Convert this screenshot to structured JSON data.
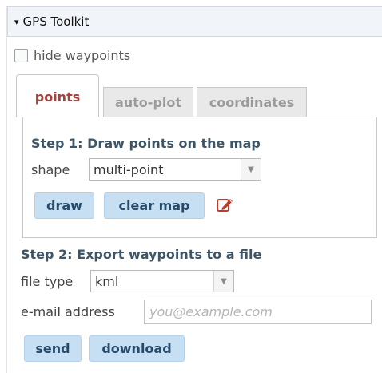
{
  "panel": {
    "title": "GPS Toolkit",
    "caret": "▾"
  },
  "hide_waypoints": {
    "label": "hide waypoints",
    "checked": false
  },
  "tabs": [
    {
      "label": "points",
      "active": true
    },
    {
      "label": "auto-plot",
      "active": false
    },
    {
      "label": "coordinates",
      "active": false
    }
  ],
  "step1": {
    "title": "Step 1: Draw points on the map",
    "shape_label": "shape",
    "shape_value": "multi-point",
    "draw_label": "draw",
    "clear_label": "clear map",
    "edit_icon": "edit-icon"
  },
  "step2": {
    "title": "Step 2: Export waypoints to a file",
    "file_type_label": "file type",
    "file_type_value": "kml",
    "email_label": "e-mail address",
    "email_placeholder": "you@example.com",
    "email_value": "",
    "send_label": "send",
    "download_label": "download"
  },
  "colors": {
    "active_tab": "#a8423d",
    "step_title": "#3d5566",
    "button_bg": "#c7dff2",
    "button_text": "#274a6b",
    "edit_icon": "#c0392b"
  }
}
